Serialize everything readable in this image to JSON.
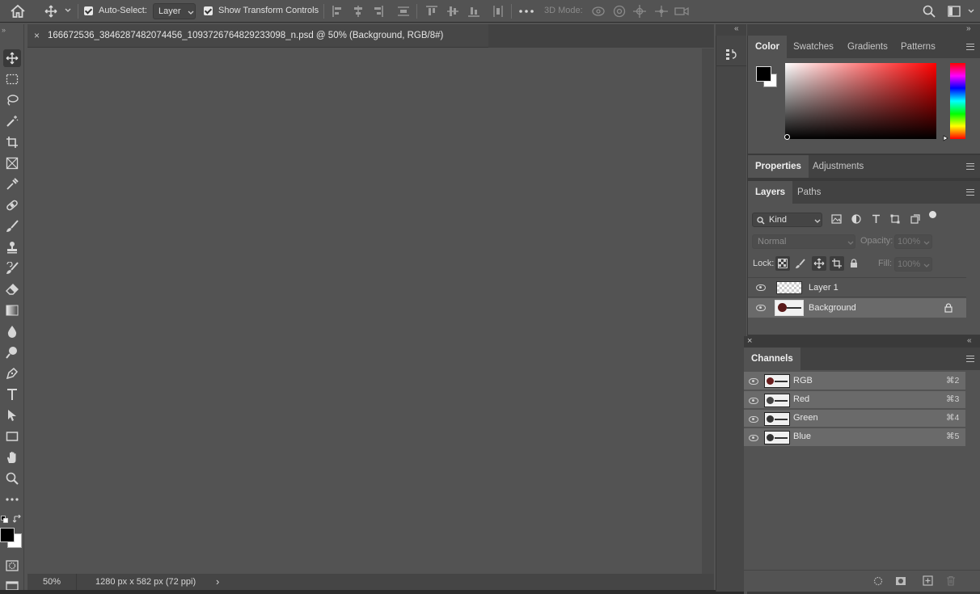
{
  "options_bar": {
    "auto_select_label": "Auto-Select:",
    "auto_select_value": "Layer",
    "transform_label": "Show Transform Controls",
    "mode_3d_label": "3D Mode:"
  },
  "document": {
    "tab_title": "166672536_3846287482074456_1093726764829233098_n.psd @ 50% (Background, RGB/8#)",
    "close_glyph": "×"
  },
  "status": {
    "zoom": "50%",
    "doc_info": "1280 px x 582 px (72 ppi)",
    "arrow": "›"
  },
  "color_panel": {
    "tabs": [
      "Color",
      "Swatches",
      "Gradients",
      "Patterns"
    ],
    "foreground": "#000000",
    "background": "#ffffff"
  },
  "properties_panel": {
    "tabs": [
      "Properties",
      "Adjustments"
    ]
  },
  "layers_panel": {
    "tabs": [
      "Layers",
      "Paths"
    ],
    "filter_kind": "Kind",
    "blend_mode": "Normal",
    "opacity_label": "Opacity:",
    "opacity_value": "100%",
    "lock_label": "Lock:",
    "fill_label": "Fill:",
    "fill_value": "100%",
    "layers": [
      {
        "name": "Layer 1",
        "visible": true,
        "locked": false,
        "selected": false
      },
      {
        "name": "Background",
        "visible": true,
        "locked": true,
        "selected": true
      }
    ]
  },
  "channels_panel": {
    "title": "Channels",
    "channels": [
      {
        "name": "RGB",
        "shortcut": "⌘2"
      },
      {
        "name": "Red",
        "shortcut": "⌘3"
      },
      {
        "name": "Green",
        "shortcut": "⌘4"
      },
      {
        "name": "Blue",
        "shortcut": "⌘5"
      }
    ]
  },
  "colors": {
    "ui_bg": "#535353",
    "panel_header": "#424242",
    "selected_row": "#6a6a6a",
    "accent_hue_red": "#ff0000"
  }
}
